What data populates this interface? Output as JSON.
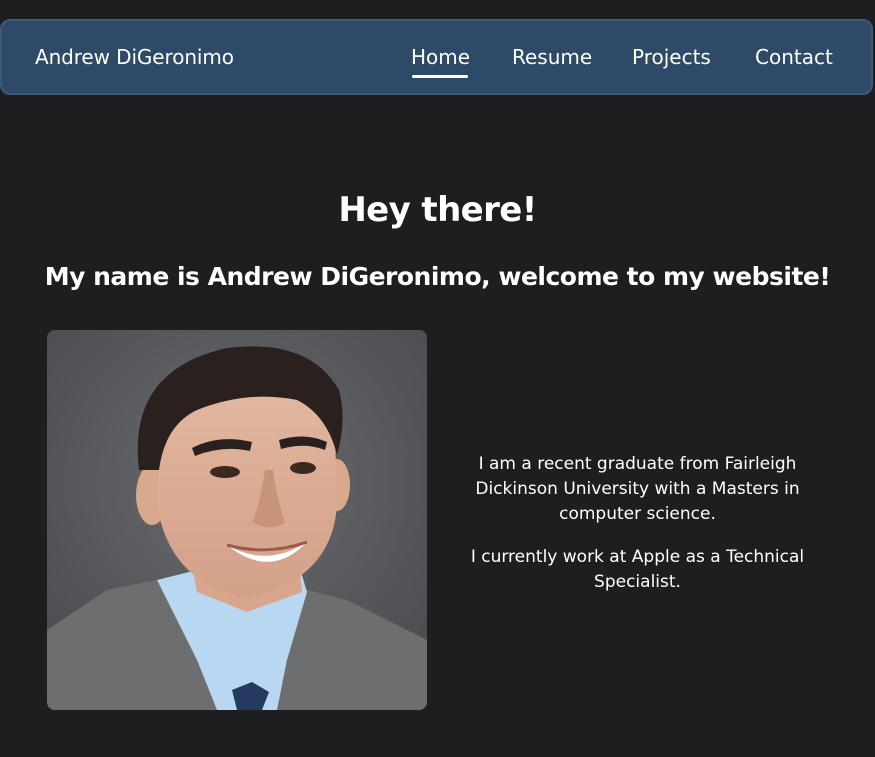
{
  "nav": {
    "brand": "Andrew DiGeronimo",
    "items": [
      {
        "label": "Home",
        "active": true
      },
      {
        "label": "Resume",
        "active": false
      },
      {
        "label": "Projects",
        "active": false
      },
      {
        "label": "Contact",
        "active": false
      }
    ]
  },
  "hero": {
    "title": "Hey there!",
    "subtitle": "My name is Andrew DiGeronimo, welcome to my website!"
  },
  "bio": {
    "paragraph1": "I am a recent graduate from Fairleigh Dickinson University with a Masters in computer science.",
    "paragraph2": "I currently work at Apple as a Technical Specialist."
  },
  "colors": {
    "background": "#1e1e20",
    "navbar": "#2e4a66",
    "text": "#ffffff"
  }
}
